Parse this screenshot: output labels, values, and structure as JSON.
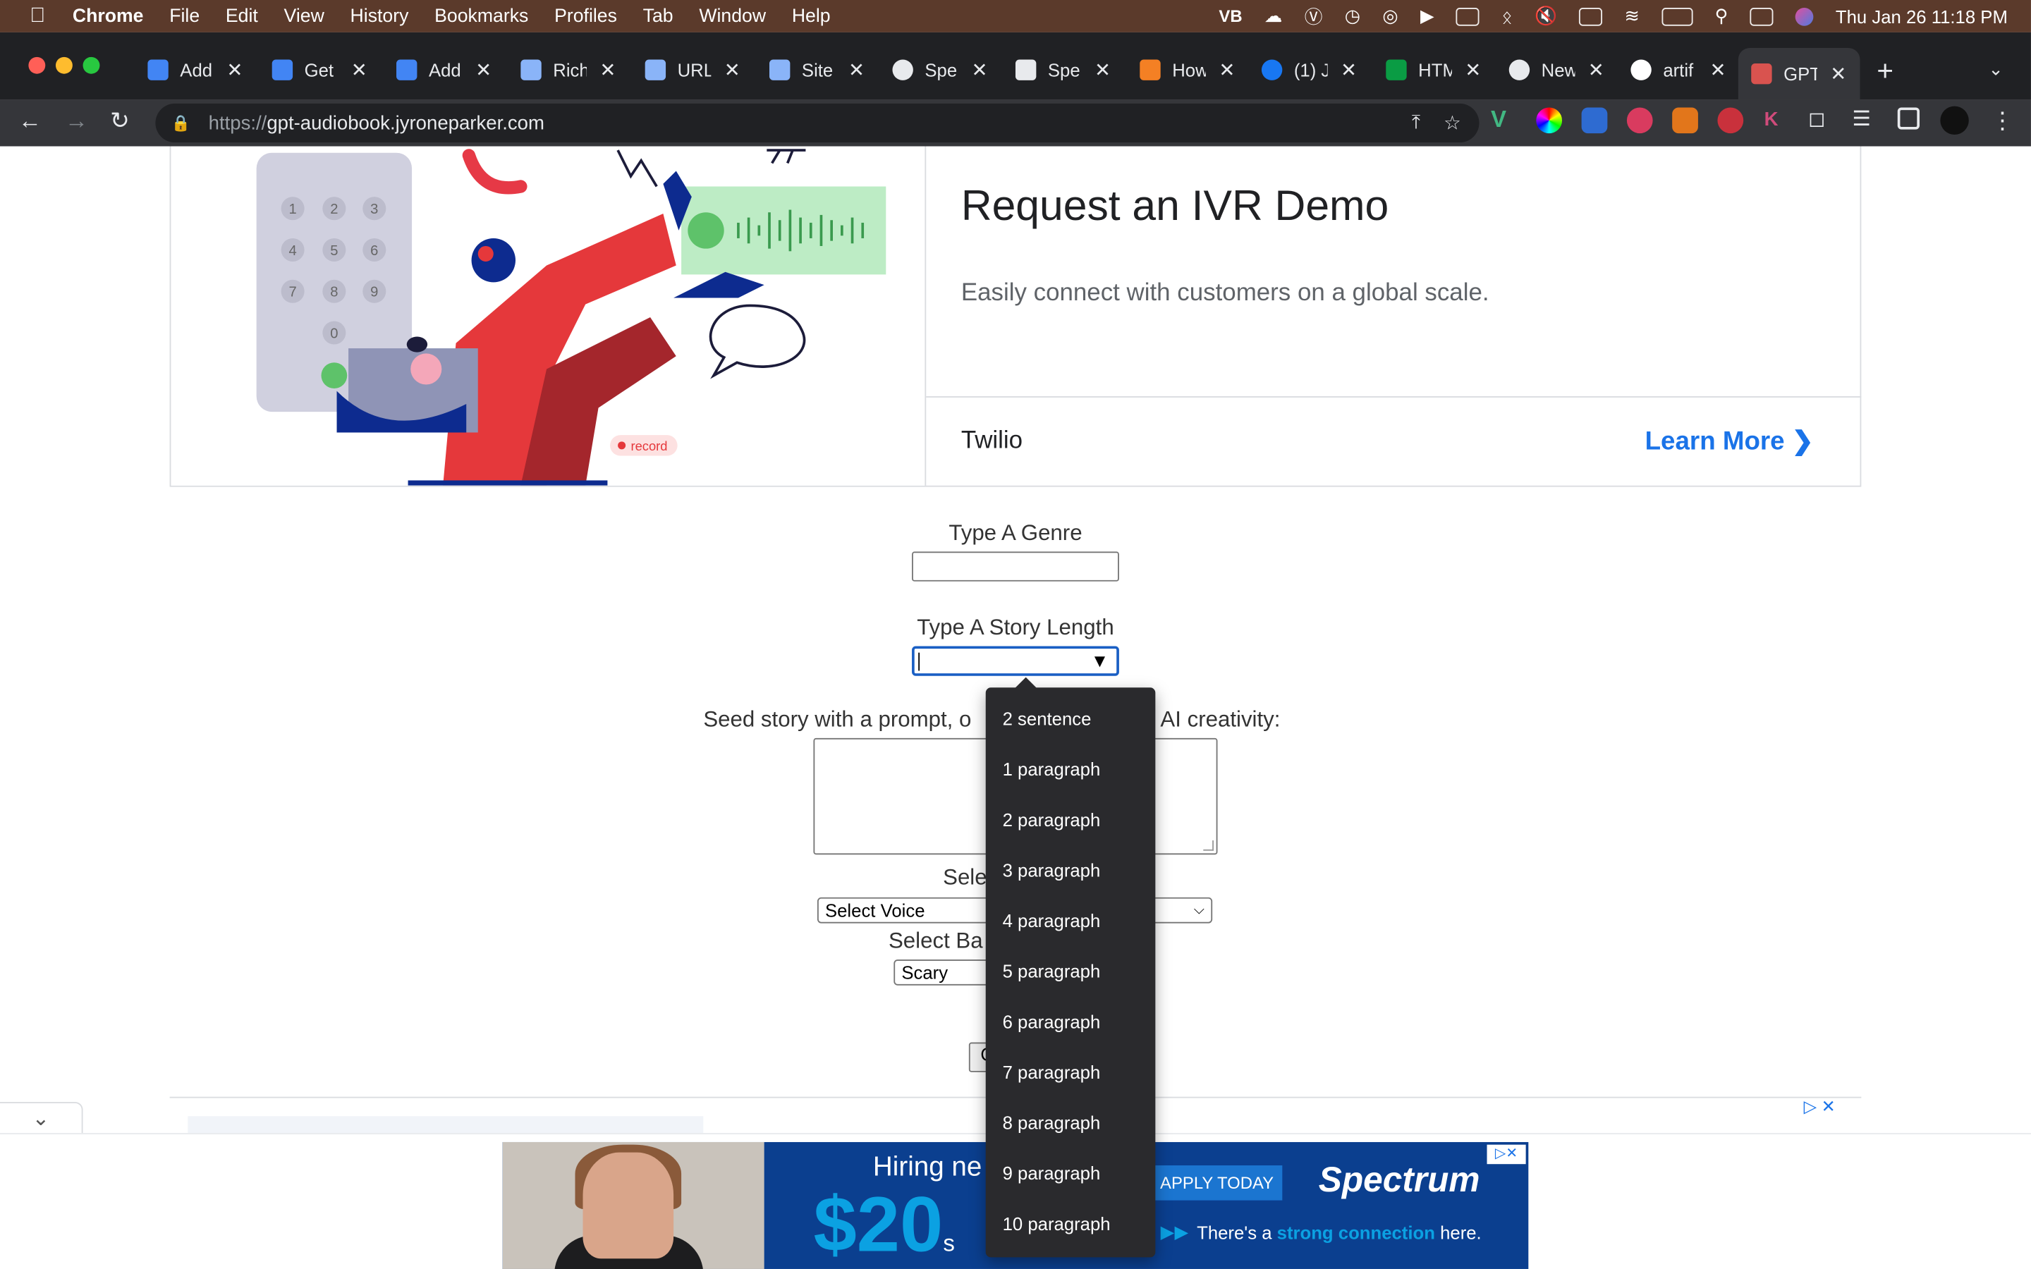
{
  "menubar": {
    "app": "Chrome",
    "items": [
      "File",
      "Edit",
      "View",
      "History",
      "Bookmarks",
      "Profiles",
      "Tab",
      "Window",
      "Help"
    ],
    "status_vb": "VB",
    "clock": "Thu Jan 26  11:18 PM"
  },
  "tabs": [
    {
      "label": "Add"
    },
    {
      "label": "Get"
    },
    {
      "label": "Add"
    },
    {
      "label": "Rich"
    },
    {
      "label": "URL"
    },
    {
      "label": "Site"
    },
    {
      "label": "Spe"
    },
    {
      "label": "Spe"
    },
    {
      "label": "How"
    },
    {
      "label": "(1) J"
    },
    {
      "label": "HTM"
    },
    {
      "label": "New"
    },
    {
      "label": "artif"
    },
    {
      "label": "GPT"
    }
  ],
  "omnibox": {
    "proto": "https://",
    "host": "gpt-audiobook.jyroneparker.com"
  },
  "ad": {
    "title": "Request an IVR Demo",
    "description": "Easily connect with customers on a global scale.",
    "brand": "Twilio",
    "cta": "Learn More",
    "record_badge": "record"
  },
  "form": {
    "genre_label": "Type A Genre",
    "genre_value": "",
    "length_label": "Type A Story Length",
    "seed_label": "Seed story with a prompt, o",
    "seed_label_tail": "total AI creativity:",
    "voice_label": "Sele",
    "voice_value": "Select Voice",
    "bg_label": "Select Ba",
    "bg_value": "Scary",
    "button_stub": "C"
  },
  "dropdown": {
    "options": [
      "2 sentence",
      "1 paragraph",
      "2 paragraph",
      "3 paragraph",
      "4 paragraph",
      "5 paragraph",
      "6 paragraph",
      "7 paragraph",
      "8 paragraph",
      "9 paragraph",
      "10 paragraph"
    ]
  },
  "banner": {
    "hiring": "Hiring ne",
    "amount": "$20",
    "amount_small": "s",
    "apply": "APPLY TODAY",
    "logo": "Spectrum",
    "tag_pre": "There's a ",
    "tag_bold": "strong connection",
    "tag_post": " here."
  },
  "colors": {
    "menubar": "#5b3a2b",
    "tabbar": "#202124",
    "toolbar": "#35363a",
    "link": "#1a73e8",
    "dropdown": "#2a2a2d",
    "spectrum_blue": "#0b3f8f"
  }
}
